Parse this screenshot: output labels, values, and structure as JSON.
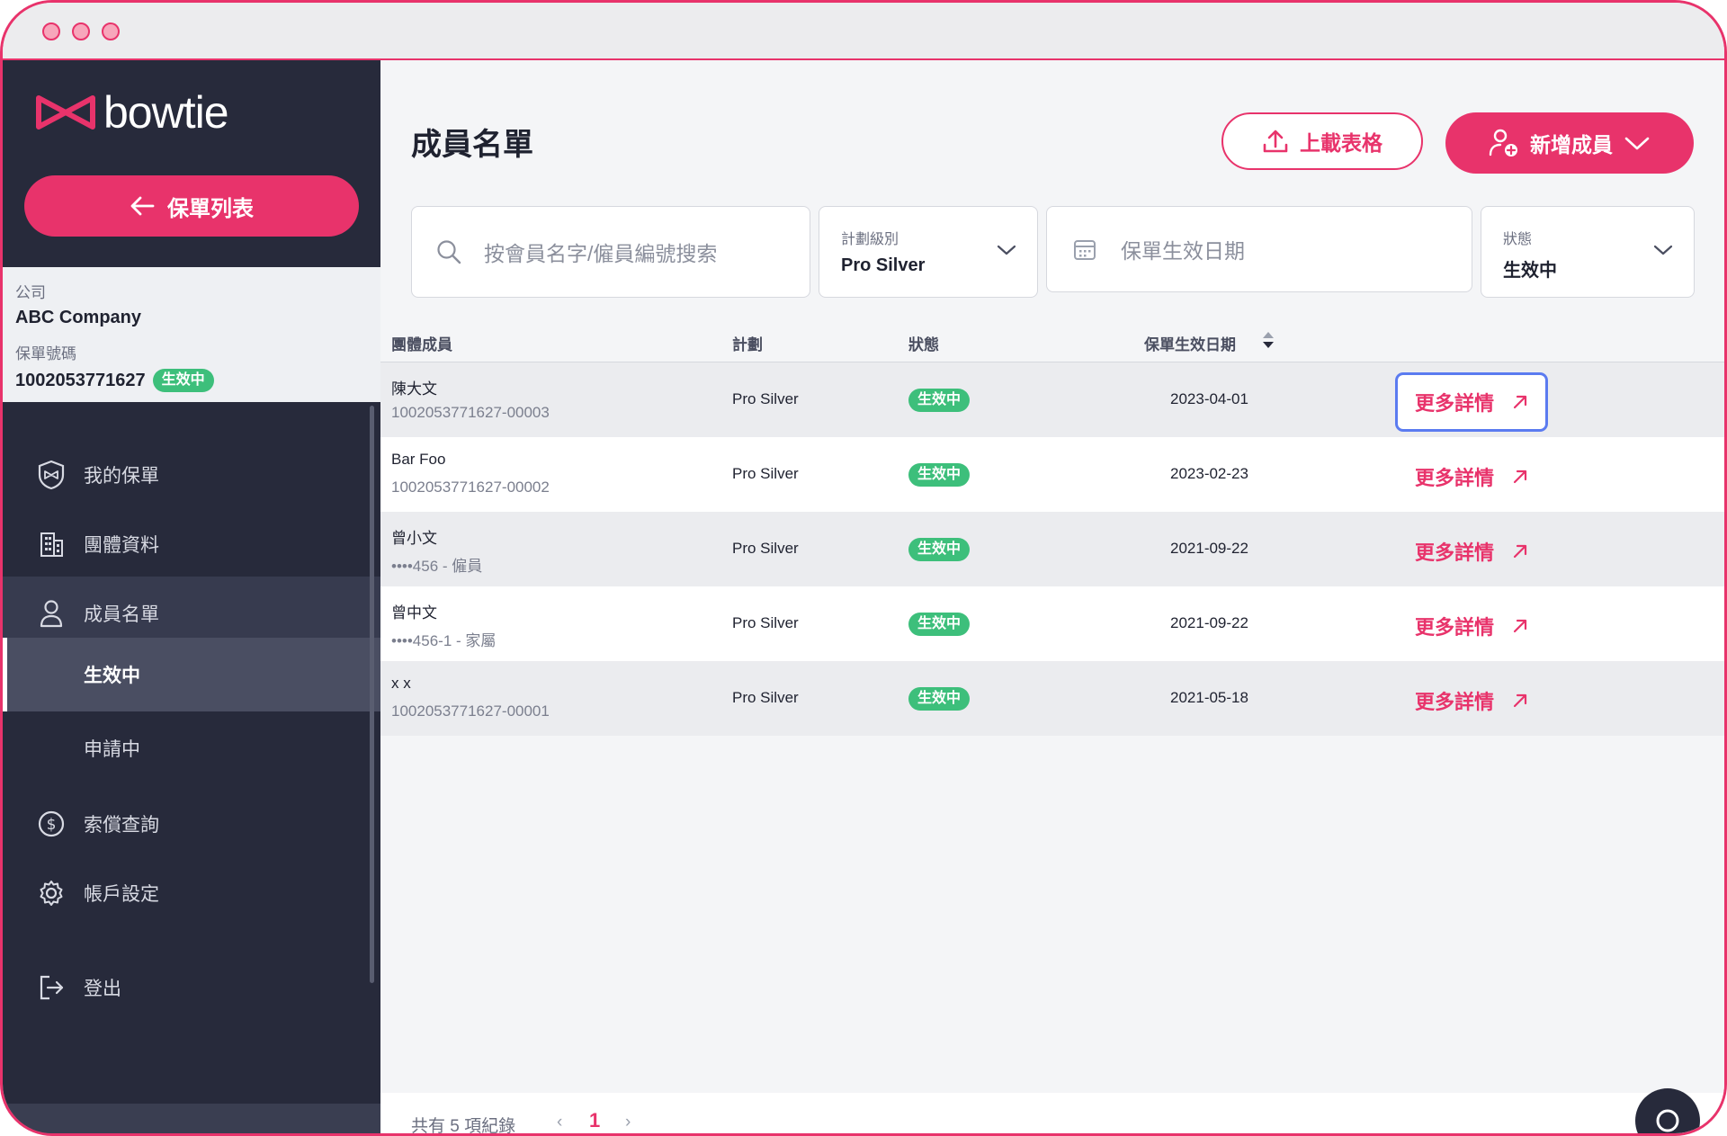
{
  "window": {
    "traffic_lights": [
      "close",
      "minimize",
      "zoom"
    ]
  },
  "sidebar": {
    "logo_text": "bowtie",
    "back_button_label": "保單列表",
    "company_label": "公司",
    "company_name": "ABC Company",
    "policy_label": "保單號碼",
    "policy_number": "1002053771627",
    "policy_status": "生效中",
    "nav": [
      {
        "label": "我的保單",
        "icon": "shield-bowtie-icon"
      },
      {
        "label": "團體資料",
        "icon": "building-icon"
      },
      {
        "label": "成員名單",
        "icon": "user-icon"
      },
      {
        "label": "索償查詢",
        "icon": "dollar-circle-icon"
      },
      {
        "label": "帳戶設定",
        "icon": "gear-icon"
      },
      {
        "label": "登出",
        "icon": "logout-icon"
      }
    ],
    "sub_nav": [
      {
        "label": "生效中",
        "selected": true
      },
      {
        "label": "申請中",
        "selected": false
      }
    ]
  },
  "main": {
    "title": "成員名單",
    "upload_button": "上載表格",
    "add_button": "新增成員",
    "search_placeholder": "按會員名字/僱員編號搜索",
    "plan_filter": {
      "label": "計劃級別",
      "value": "Pro Silver"
    },
    "date_filter_placeholder": "保單生效日期",
    "status_filter": {
      "label": "狀態",
      "value": "生效中"
    },
    "table": {
      "headers": [
        "團體成員",
        "計劃",
        "狀態",
        "保單生效日期"
      ],
      "rows": [
        {
          "name": "陳大文",
          "id": "1002053771627-00003",
          "plan": "Pro Silver",
          "status": "生效中",
          "date": "2023-04-01",
          "action": "更多詳情"
        },
        {
          "name": "Bar Foo",
          "id": "1002053771627-00002",
          "plan": "Pro Silver",
          "status": "生效中",
          "date": "2023-02-23",
          "action": "更多詳情"
        },
        {
          "name": "曾小文",
          "id": "••••456 - 僱員",
          "plan": "Pro Silver",
          "status": "生效中",
          "date": "2021-09-22",
          "action": "更多詳情"
        },
        {
          "name": "曾中文",
          "id": "••••456-1 - 家屬",
          "plan": "Pro Silver",
          "status": "生效中",
          "date": "2021-09-22",
          "action": "更多詳情"
        },
        {
          "name": "x x",
          "id": "1002053771627-00001",
          "plan": "Pro Silver",
          "status": "生效中",
          "date": "2021-05-18",
          "action": "更多詳情"
        }
      ]
    },
    "footer": {
      "total_text": "共有 5 項紀錄",
      "prev": "‹",
      "current_page": "1",
      "next": "›"
    }
  },
  "colors": {
    "brand": "#e8336b",
    "sidebar": "#272a3b",
    "status_green": "#3dbf7b",
    "focus_ring": "#5b7bf0"
  }
}
